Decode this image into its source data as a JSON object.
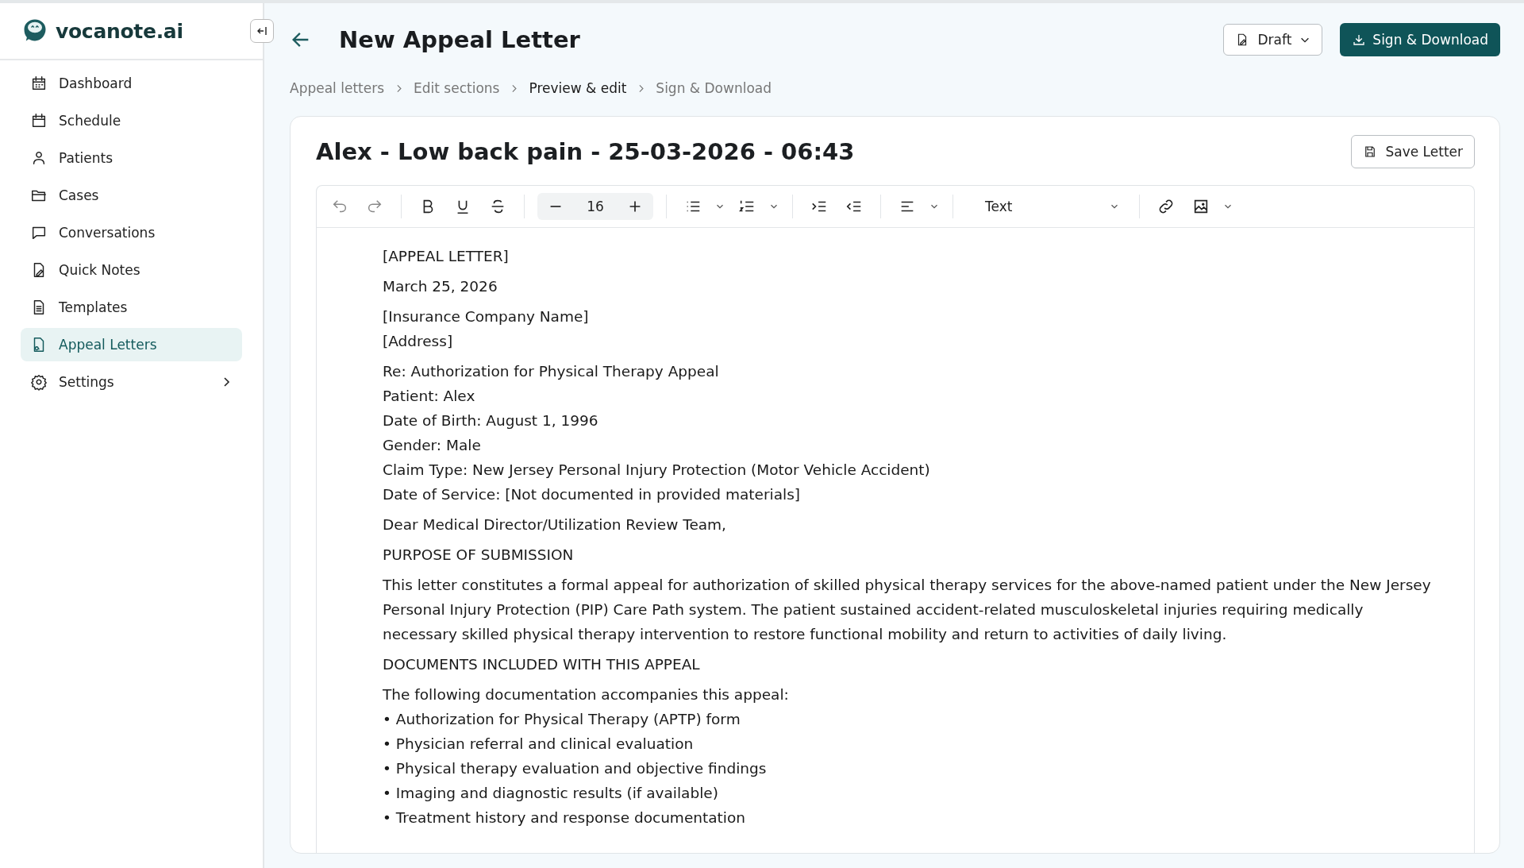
{
  "brand": {
    "name": "vocanote.ai"
  },
  "sidebar": {
    "items": [
      {
        "label": "Dashboard",
        "selected": false
      },
      {
        "label": "Schedule",
        "selected": false
      },
      {
        "label": "Patients",
        "selected": false
      },
      {
        "label": "Cases",
        "selected": false
      },
      {
        "label": "Conversations",
        "selected": false
      },
      {
        "label": "Quick Notes",
        "selected": false
      },
      {
        "label": "Templates",
        "selected": false
      },
      {
        "label": "Appeal Letters",
        "selected": true
      },
      {
        "label": "Settings",
        "selected": false,
        "has_submenu": true
      }
    ]
  },
  "header": {
    "title": "New Appeal Letter",
    "status": "Draft",
    "primary_button": "Sign & Download"
  },
  "breadcrumbs": [
    {
      "label": "Appeal letters",
      "current": false
    },
    {
      "label": "Edit sections",
      "current": false
    },
    {
      "label": "Preview & edit",
      "current": true
    },
    {
      "label": "Sign & Download",
      "current": false
    }
  ],
  "letter": {
    "title": "Alex - Low back pain - 25-03-2026 - 06:43",
    "save_button": "Save Letter",
    "toolbar": {
      "font_size": "16",
      "block_style": "Text"
    },
    "paragraphs": [
      {
        "lines": [
          "[APPEAL LETTER]"
        ]
      },
      {
        "lines": [
          "March 25, 2026"
        ]
      },
      {
        "lines": [
          "[Insurance Company Name]",
          "[Address]"
        ]
      },
      {
        "lines": [
          "Re: Authorization for Physical Therapy Appeal",
          "Patient: Alex",
          "Date of Birth: August 1, 1996",
          "Gender: Male",
          "Claim Type: New Jersey Personal Injury Protection (Motor Vehicle Accident)",
          "Date of Service: [Not documented in provided materials]"
        ]
      },
      {
        "lines": [
          "Dear Medical Director/Utilization Review Team,"
        ]
      },
      {
        "lines": [
          "PURPOSE OF SUBMISSION"
        ]
      },
      {
        "lines": [
          "This letter constitutes a formal appeal for authorization of skilled physical therapy services for the above-named patient under the New Jersey Personal Injury Protection (PIP) Care Path system. The patient sustained accident-related musculoskeletal injuries requiring medically necessary skilled physical therapy intervention to restore functional mobility and return to activities of daily living."
        ]
      },
      {
        "lines": [
          "DOCUMENTS INCLUDED WITH THIS APPEAL"
        ]
      },
      {
        "lines": [
          "The following documentation accompanies this appeal:",
          "• Authorization for Physical Therapy (APTP) form",
          "• Physician referral and clinical evaluation",
          "• Physical therapy evaluation and objective findings",
          "• Imaging and diagnostic results (if available)",
          "• Treatment history and response documentation"
        ]
      }
    ]
  }
}
